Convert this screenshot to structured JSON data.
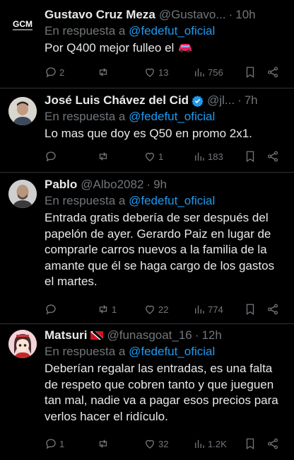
{
  "tweets": [
    {
      "name": "Gustavo Cruz Meza",
      "handle": "@Gustavo...",
      "time": "10h",
      "reply_prefix": "En respuesta a",
      "reply_to": "@fedefut_oficial",
      "text": "Por Q400 mejor fulleo el",
      "emoji": "car-emoji",
      "avatar_text": "GCM",
      "stats": {
        "replies": "2",
        "retweets": "",
        "likes": "13",
        "views": "756"
      }
    },
    {
      "name": "José Luis Chávez del Cid",
      "handle": "@jl...",
      "time": "7h",
      "verified": true,
      "reply_prefix": "En respuesta a",
      "reply_to": "@fedefut_oficial",
      "text": "Lo mas que doy es Q50 en promo 2x1.",
      "stats": {
        "replies": "",
        "retweets": "",
        "likes": "1",
        "views": "183"
      }
    },
    {
      "name": "Pablo",
      "handle": "@Albo2082",
      "time": "9h",
      "reply_prefix": "En respuesta a",
      "reply_to": "@fedefut_oficial",
      "text": "Entrada gratis debería de ser después del papelón de ayer. Gerardo Paiz en lugar de comprarle carros nuevos a la familia de la amante que él se haga cargo de los gastos el martes.",
      "stats": {
        "replies": "",
        "retweets": "1",
        "likes": "22",
        "views": "774"
      }
    },
    {
      "name": "Matsuri",
      "handle": "@funasgoat_16",
      "time": "12h",
      "flag": "trinidad-tobago-flag",
      "reply_prefix": "En respuesta a",
      "reply_to": "@fedefut_oficial",
      "text": "Deberían regalar las entradas, es una falta de respeto que cobren tanto y que jueguen tan mal, nadie va a pagar esos precios para verlos hacer el ridículo.",
      "stats": {
        "replies": "1",
        "retweets": "",
        "likes": "32",
        "views": "1.2K"
      }
    }
  ],
  "colors": {
    "background": "#000000",
    "text": "#e7e9ea",
    "muted": "#71767b",
    "link": "#1d9bf0",
    "divider": "#2f3336"
  }
}
